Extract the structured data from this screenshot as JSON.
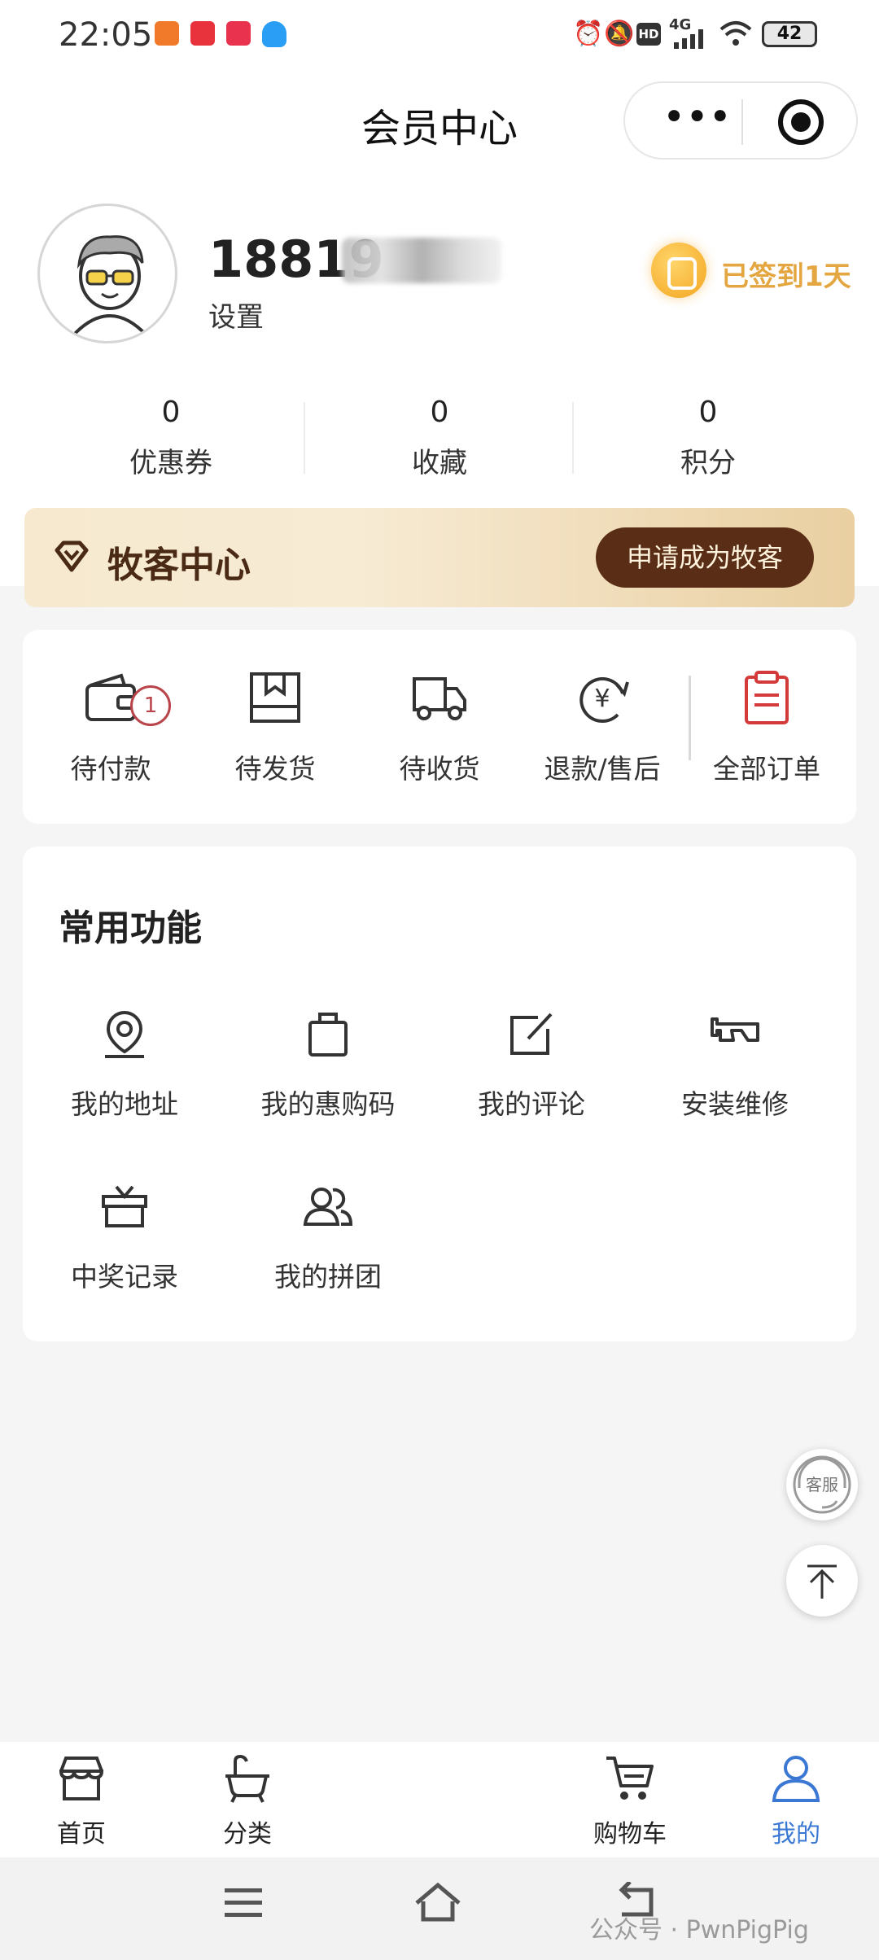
{
  "status_bar": {
    "time": "22:05",
    "network": "4G",
    "hd": "HD",
    "battery": "42"
  },
  "header": {
    "title": "会员中心",
    "more_icon": "more-dots-icon",
    "target_icon": "target-icon"
  },
  "profile": {
    "phone": "18819",
    "settings_label": "设置",
    "checkin_label": "已签到1天"
  },
  "stats": [
    {
      "value": "0",
      "label": "优惠券"
    },
    {
      "value": "0",
      "label": "收藏"
    },
    {
      "value": "0",
      "label": "积分"
    }
  ],
  "banner": {
    "title": "牧客中心",
    "button": "申请成为牧客"
  },
  "orders": [
    {
      "label": "待付款",
      "icon": "wallet-icon",
      "badge": "1"
    },
    {
      "label": "待发货",
      "icon": "box-icon"
    },
    {
      "label": "待收货",
      "icon": "truck-icon"
    },
    {
      "label": "退款/售后",
      "icon": "refund-icon"
    },
    {
      "label": "全部订单",
      "icon": "clipboard-icon"
    }
  ],
  "functions": {
    "title": "常用功能",
    "items": [
      {
        "label": "我的地址",
        "icon": "location-icon"
      },
      {
        "label": "我的惠购码",
        "icon": "shopping-bag-icon"
      },
      {
        "label": "我的评论",
        "icon": "edit-icon"
      },
      {
        "label": "安装维修",
        "icon": "tool-icon"
      },
      {
        "label": "中奖记录",
        "icon": "gift-icon"
      },
      {
        "label": "我的拼团",
        "icon": "group-icon"
      }
    ]
  },
  "floating": {
    "service_label": "客服",
    "top_icon": "back-to-top-icon"
  },
  "tabbar": [
    {
      "label": "首页",
      "icon": "store-icon"
    },
    {
      "label": "分类",
      "icon": "bathtub-icon"
    },
    {
      "label": "购物车",
      "icon": "cart-icon"
    },
    {
      "label": "我的",
      "icon": "user-icon",
      "active": true
    }
  ],
  "colors": {
    "accent_gold": "#e3a640",
    "banner_button": "#5a2e16",
    "active_tab": "#3a78d4",
    "badge": "#b9444a"
  },
  "watermark": "公众号 · PwnPigPig"
}
